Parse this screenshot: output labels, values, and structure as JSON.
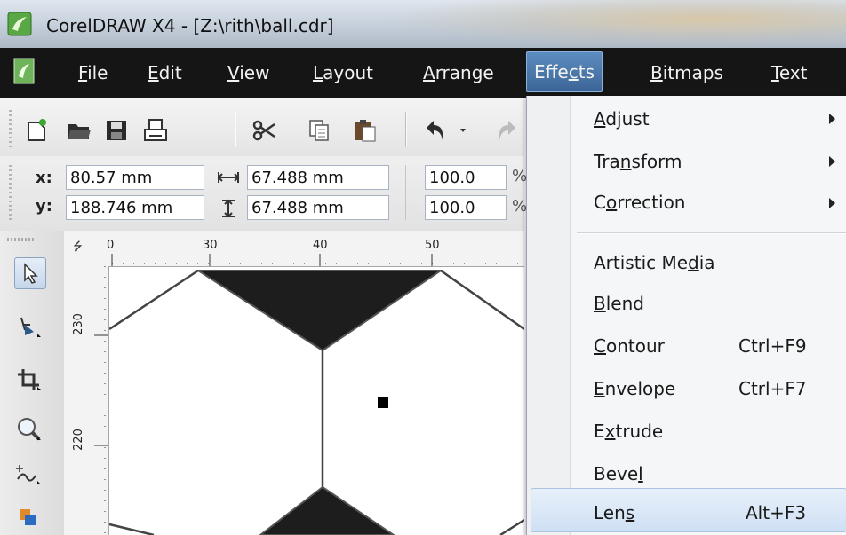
{
  "window": {
    "title": "CorelDRAW X4 - [Z:\\rith\\ball.cdr]"
  },
  "menubar": {
    "items": [
      {
        "key": "F",
        "rest": "ile"
      },
      {
        "key": "E",
        "rest": "dit"
      },
      {
        "key": "V",
        "rest": "iew"
      },
      {
        "key": "L",
        "rest": "ayout"
      },
      {
        "key": "A",
        "rest": "rrange"
      },
      {
        "pre": "Effe",
        "key": "c",
        "rest": "ts"
      },
      {
        "key": "B",
        "rest": "itmaps"
      },
      {
        "key": "T",
        "rest": "ext"
      }
    ]
  },
  "propbar": {
    "x_label": "x:",
    "y_label": "y:",
    "x_value": "80.57 mm",
    "y_value": "188.746 mm",
    "width_value": "67.488 mm",
    "height_value": "67.488 mm",
    "scale_x": "100.0",
    "scale_y": "100.0",
    "pct_sign": "%"
  },
  "rulers": {
    "top_labels": [
      "0",
      "30",
      "40",
      "50"
    ],
    "left_labels": [
      "230",
      "220"
    ]
  },
  "effects_menu": {
    "adjust": {
      "key": "A",
      "rest": "djust"
    },
    "transform": {
      "pre": "Tra",
      "key": "n",
      "rest": "sform"
    },
    "correction": {
      "pre": "C",
      "key": "o",
      "rest": "rrection"
    },
    "artistic_media": {
      "pre": "Artistic Me",
      "key": "d",
      "rest": "ia"
    },
    "blend": {
      "key": "B",
      "rest": "lend"
    },
    "contour": {
      "key": "C",
      "rest": "ontour",
      "shortcut": "Ctrl+F9"
    },
    "envelope": {
      "key": "E",
      "rest": "nvelope",
      "shortcut": "Ctrl+F7"
    },
    "extrude": {
      "pre": "E",
      "key": "x",
      "rest": "trude"
    },
    "bevel": {
      "pre": "Beve",
      "key": "l",
      "rest": ""
    },
    "lens": {
      "pre": "Len",
      "key": "s",
      "rest": "",
      "shortcut": "Alt+F3"
    }
  },
  "colors": {
    "menubar_bg": "#151515",
    "active_menu": "#4a78ad",
    "highlight": "#cfe0f4"
  }
}
